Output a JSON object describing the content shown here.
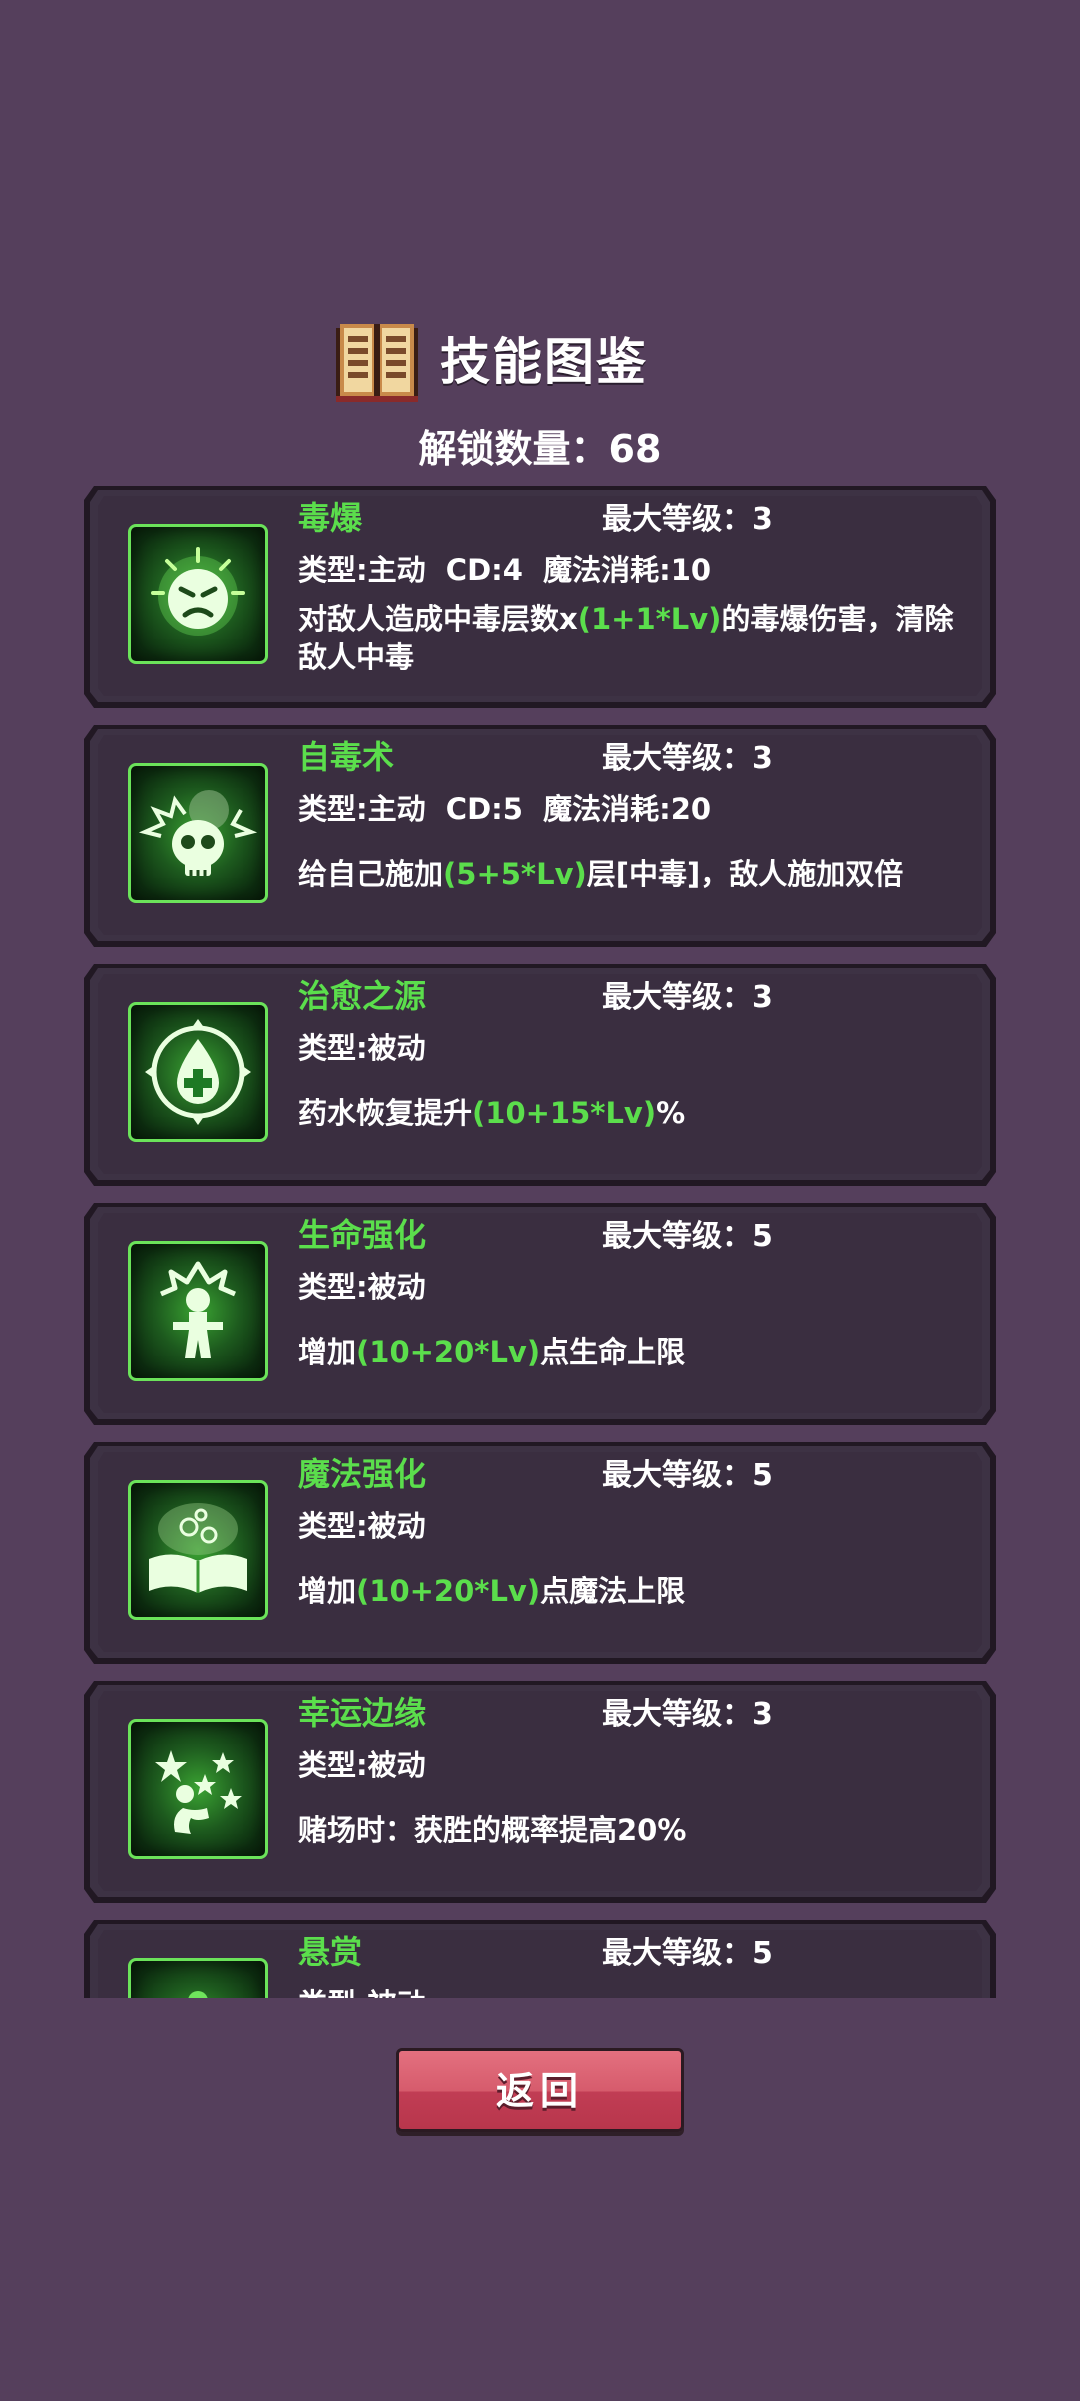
{
  "header": {
    "title": "技能图鉴",
    "unlock_text": "解锁数量：68"
  },
  "skills": [
    {
      "name": "毒爆",
      "max_level": "最大等级：3",
      "type": "类型:主动  CD:4  魔法消耗:10",
      "desc_before": "对敌人造成中毒层数x",
      "desc_highlight": "(1+1*Lv)",
      "desc_after": "的毒爆伤害，清除敌人中毒",
      "icon": "angry-face-burst-icon"
    },
    {
      "name": "自毒术",
      "max_level": "最大等级：3",
      "type": "类型:主动  CD:5  魔法消耗:20",
      "desc_before": "给自己施加",
      "desc_highlight": "(5+5*Lv)",
      "desc_after": "层[中毒]，敌人施加双倍",
      "icon": "skull-burst-icon"
    },
    {
      "name": "治愈之源",
      "max_level": "最大等级：3",
      "type": "类型:被动",
      "desc_before": "药水恢复提升",
      "desc_highlight": "(10+15*Lv)",
      "desc_after": "%",
      "icon": "healing-drop-icon"
    },
    {
      "name": "生命强化",
      "max_level": "最大等级：5",
      "type": "类型:被动",
      "desc_before": "增加",
      "desc_highlight": "(10+20*Lv)",
      "desc_after": "点生命上限",
      "icon": "person-burst-icon"
    },
    {
      "name": "魔法强化",
      "max_level": "最大等级：5",
      "type": "类型:被动",
      "desc_before": "增加",
      "desc_highlight": "(10+20*Lv)",
      "desc_after": "点魔法上限",
      "icon": "spellbook-icon"
    },
    {
      "name": "幸运边缘",
      "max_level": "最大等级：3",
      "type": "类型:被动",
      "desc_before": "赌场时：获胜的概率提高20%",
      "desc_highlight": "",
      "desc_after": "",
      "icon": "lucky-stars-icon"
    },
    {
      "name": "悬赏",
      "max_level": "最大等级：5",
      "type": "类型:被动",
      "desc_before": "",
      "desc_highlight": "",
      "desc_after": "",
      "icon": "bounty-icon"
    }
  ],
  "buttons": {
    "back_label": "返回"
  },
  "colors": {
    "background": "#553f5c",
    "card": "#3b2f41",
    "highlight_green": "#5bde4c",
    "button_red": "#d65b6c"
  }
}
